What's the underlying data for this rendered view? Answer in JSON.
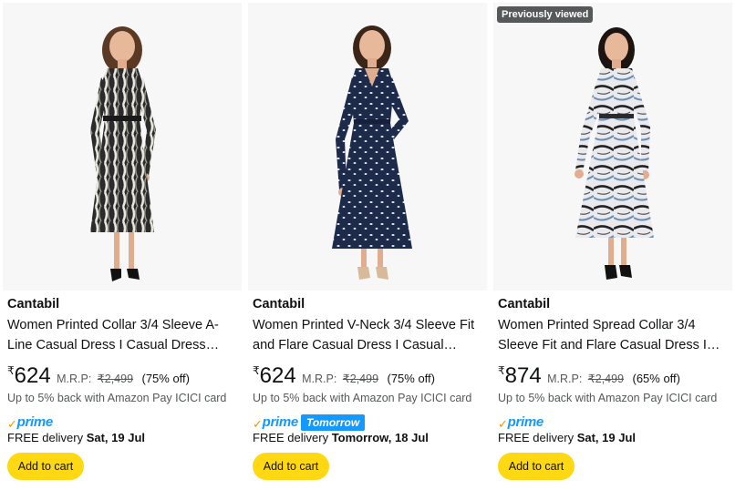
{
  "products": [
    {
      "badge": "",
      "brand": "Cantabil",
      "title": "Women Printed Collar 3/4 Sleeve A-Line Casual Dress I Casual Dress for…",
      "currency": "₹",
      "price": "624",
      "mrp_label": "M.R.P:",
      "mrp_value": "₹2,499",
      "discount": "(75% off)",
      "cashback": "Up to 5% back with Amazon Pay ICICI card",
      "prime_label": "prime",
      "prime_tag": "",
      "delivery_prefix": "FREE delivery",
      "delivery_date": "Sat, 19 Jul",
      "cart_label": "Add to cart",
      "image": {
        "dress": "#2b2b2b",
        "pattern": "#e8e6de",
        "style": "stripes"
      }
    },
    {
      "badge": "",
      "brand": "Cantabil",
      "title": "Women Printed V-Neck 3/4 Sleeve Fit and Flare Casual Dress I Casual Dres…",
      "currency": "₹",
      "price": "624",
      "mrp_label": "M.R.P:",
      "mrp_value": "₹2,499",
      "discount": "(75% off)",
      "cashback": "Up to 5% back with Amazon Pay ICICI card",
      "prime_label": "prime",
      "prime_tag": "Tomorrow",
      "delivery_prefix": "FREE delivery",
      "delivery_date": "Tomorrow, 18 Jul",
      "cart_label": "Add to cart",
      "image": {
        "dress": "#1e2a4a",
        "pattern": "#dfe6f2",
        "style": "dots"
      }
    },
    {
      "badge": "Previously viewed",
      "brand": "Cantabil",
      "title": "Women Printed Spread Collar 3/4 Sleeve Fit and Flare Casual Dress I…",
      "currency": "₹",
      "price": "874",
      "mrp_label": "M.R.P:",
      "mrp_value": "₹2,499",
      "discount": "(65% off)",
      "cashback": "Up to 5% back with Amazon Pay ICICI card",
      "prime_label": "prime",
      "prime_tag": "",
      "delivery_prefix": "FREE delivery",
      "delivery_date": "Sat, 19 Jul",
      "cart_label": "Add to cart",
      "image": {
        "dress": "#e9e9ee",
        "pattern": "#222222",
        "style": "swirl"
      }
    }
  ],
  "colors": {
    "cart_button": "#ffd814",
    "prime_blue": "#1399ff",
    "prime_check": "#f79400",
    "muted_text": "#565959",
    "image_bg": "#f7f7f7"
  }
}
